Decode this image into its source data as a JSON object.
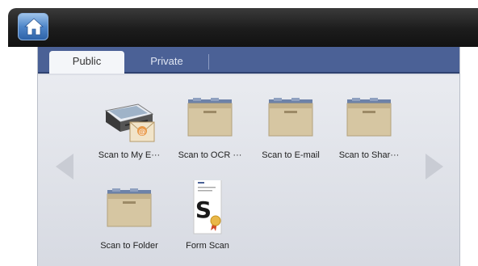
{
  "header": {
    "home_icon": "home-icon"
  },
  "tabs": [
    {
      "label": "Public",
      "selected": true
    },
    {
      "label": "Private",
      "selected": false
    }
  ],
  "nav": {
    "prev_icon": "chevron-left-icon",
    "next_icon": "chevron-right-icon"
  },
  "items": [
    {
      "label": "Scan to My E···",
      "icon": "scanner-email-icon"
    },
    {
      "label": "Scan to OCR ···",
      "icon": "folder-tray-icon"
    },
    {
      "label": "Scan to E-mail",
      "icon": "folder-tray-icon"
    },
    {
      "label": "Scan to Shar···",
      "icon": "folder-tray-icon"
    },
    {
      "label": "Scan to Folder",
      "icon": "folder-tray-icon"
    },
    {
      "label": "Form Scan",
      "icon": "form-document-icon"
    }
  ],
  "colors": {
    "tabbar": "#4b6196",
    "panel": "#dcdfe6",
    "topbar": "#1c1c1c",
    "home_button": "#4f86c9"
  }
}
